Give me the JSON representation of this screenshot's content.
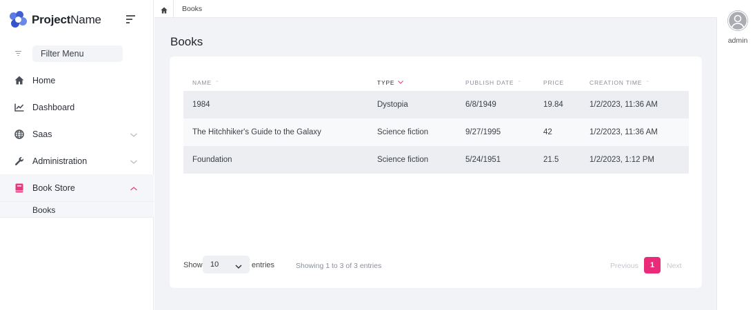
{
  "brand": {
    "name_bold": "Project",
    "name_regular": "Name"
  },
  "filter": {
    "placeholder": "Filter Menu"
  },
  "sidebar": {
    "items": [
      {
        "label": "Home",
        "icon": "home-icon"
      },
      {
        "label": "Dashboard",
        "icon": "chart-icon"
      },
      {
        "label": "Saas",
        "icon": "globe-icon"
      },
      {
        "label": "Administration",
        "icon": "wrench-icon"
      },
      {
        "label": "Book Store",
        "icon": "book-icon"
      }
    ],
    "sub_items": [
      {
        "label": "Books"
      }
    ]
  },
  "breadcrumb": {
    "items": [
      "Books"
    ]
  },
  "page": {
    "title": "Books"
  },
  "table": {
    "columns": [
      "NAME",
      "TYPE",
      "PUBLISH DATE",
      "PRICE",
      "CREATION TIME"
    ],
    "rows": [
      [
        "1984",
        "Dystopia",
        "6/8/1949",
        "19.84",
        "1/2/2023, 11:36 AM"
      ],
      [
        "The Hitchhiker's Guide to the Galaxy",
        "Science fiction",
        "9/27/1995",
        "42",
        "1/2/2023, 11:36 AM"
      ],
      [
        "Foundation",
        "Science fiction",
        "5/24/1951",
        "21.5",
        "1/2/2023, 1:12 PM"
      ]
    ]
  },
  "footer": {
    "show_label": "Show",
    "page_size": "10",
    "entries_label": "entries",
    "info": "Showing 1 to 3 of 3 entries",
    "previous": "Previous",
    "current_page": "1",
    "next": "Next"
  },
  "user": {
    "name": "admin"
  },
  "colors": {
    "accent": "#ea2b7a",
    "brand": "#4f6fe0",
    "background": "#f1f3f6"
  }
}
